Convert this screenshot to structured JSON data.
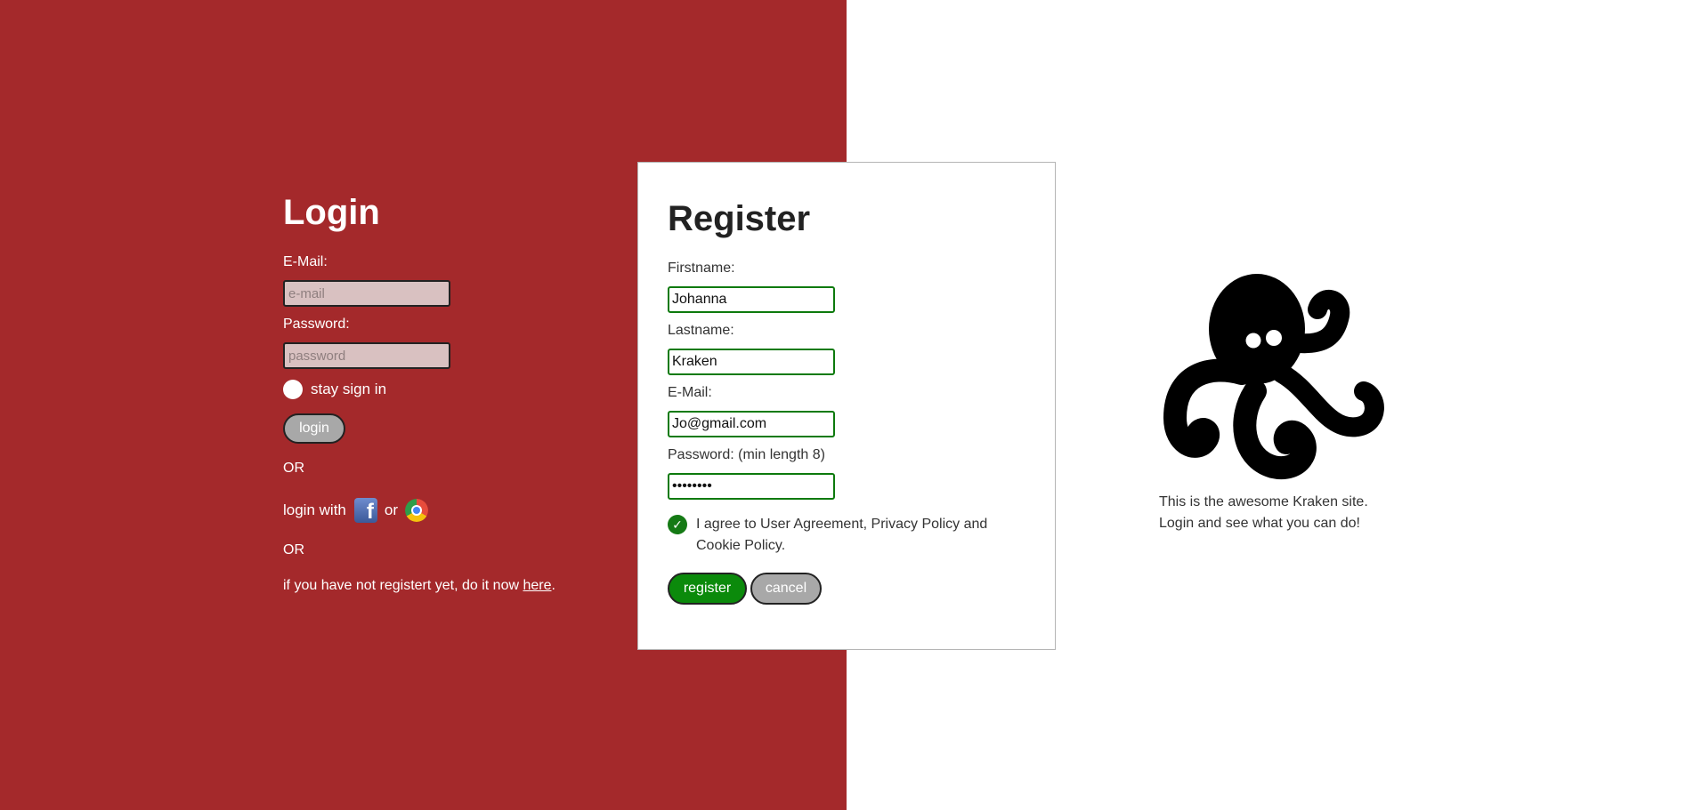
{
  "login": {
    "title": "Login",
    "email_label": "E-Mail:",
    "email_placeholder": "e-mail",
    "password_label": "Password:",
    "password_placeholder": "password",
    "stay_label": "stay sign in",
    "login_button": "login",
    "or_1": "OR",
    "login_with": "login with",
    "or_word": "or",
    "or_2": "OR",
    "register_prompt": "if you have not registert yet, do it now",
    "register_link": "here",
    "register_suffix": "."
  },
  "register": {
    "title": "Register",
    "firstname_label": "Firstname:",
    "firstname_value": "Johanna",
    "lastname_label": "Lastname:",
    "lastname_value": "Kraken",
    "email_label": "E-Mail:",
    "email_value": "Jo@gmail.com",
    "password_label": "Password: (min length 8)",
    "password_value": "********",
    "agree_text": "I agree to User Agreement, Privacy Policy and Cookie Policy.",
    "agree_checked": true,
    "register_button": "register",
    "cancel_button": "cancel"
  },
  "site": {
    "tagline_line1": "This is the awesome Kraken site.",
    "tagline_line2": "Login and see what you can do!"
  },
  "icons": {
    "facebook": "facebook-icon",
    "chrome": "chrome-icon",
    "logo": "kraken-logo",
    "check": "check-icon"
  },
  "colors": {
    "left_bg": "#a4292b",
    "register_green": "#0b8a0b",
    "cancel_gray": "#a8a8a8"
  }
}
